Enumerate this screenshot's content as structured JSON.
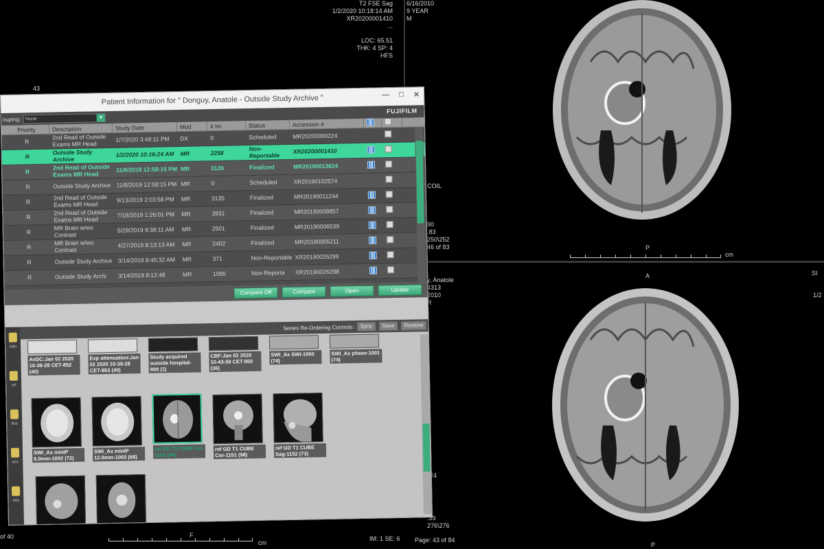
{
  "overlay_top_right": {
    "sequence": "T2 FSE Sag",
    "datetime": "1/2/2020 10:18:14 AM",
    "accession": "XR20200001410",
    "ellipsis": "...",
    "loc": "LOC: 65.51",
    "thk": "THK: 4 SP: 4",
    "position": "HFS",
    "dob": "6/16/2010",
    "age": "9 YEAR",
    "sex": "M"
  },
  "overlay_top_left": {
    "slice_num": "43"
  },
  "overlay_mid": {
    "coil": "COIL",
    "l1": "90",
    "l2": ".83",
    "l3": "250\\252",
    "l4": "46 of 83",
    "orient_bottom_top": "P",
    "cm_top": "cm"
  },
  "overlay_bottom": {
    "patient_name": "y, Anatole",
    "id_partial": "4313",
    "date_partial": "2010",
    "sex_partial": "R",
    "orient_a": "A",
    "right_s": "SI",
    "right_date": "1/2",
    "l24": "24",
    "l_ud": "l/",
    "l39": ".39",
    "l276": "276\\276",
    "page": "Page: 43 of 84",
    "im_se": "IM: 1 SE: 6",
    "of40": "of 40",
    "orient_f": "F",
    "cm_bot": "cm",
    "orient_p_bot": "P"
  },
  "dialog": {
    "title": "Patient Information for \" Donguy, Anatole  - Outside Study Archive \"",
    "win_min": "—",
    "win_max": "□",
    "win_close": "✕",
    "brand": "FUJIFILM",
    "grouping_label": "ouping:",
    "grouping_value": "None",
    "grouping_arrow": "▼",
    "columns": [
      "Priority",
      "Description",
      "Study Date",
      "Mod",
      "# Im",
      "Status",
      "Accession #"
    ],
    "rows": [
      {
        "priority": "R",
        "description": "2nd Read of Outside Exams MR Head",
        "date": "1/7/2020 3:49:11 PM",
        "mod": "DX",
        "im": "0",
        "status": "Scheduled",
        "accession": "MR20200000224",
        "icon": false
      },
      {
        "priority": "R",
        "description": "Outside Study Archive",
        "date": "1/2/2020 10:16:24 AM",
        "mod": "MR",
        "im": "2258",
        "status": "Non-Reportable",
        "accession": "XR20200001410",
        "icon": true
      },
      {
        "priority": "R",
        "description": "2nd Read of Outside Exams MR Head",
        "date": "11/8/2019 12:58:15 PM",
        "mod": "MR",
        "im": "3126",
        "status": "Finalized",
        "accession": "MR20190013824",
        "icon": true
      },
      {
        "priority": "R",
        "description": "Outside Study Archive",
        "date": "11/8/2019 12:58:15 PM",
        "mod": "MR",
        "im": "0",
        "status": "Scheduled",
        "accession": "XR20190102574",
        "icon": false
      },
      {
        "priority": "R",
        "description": "2nd Read of Outside Exams MR Head",
        "date": "9/13/2019 2:03:58 PM",
        "mod": "MR",
        "im": "3135",
        "status": "Finalized",
        "accession": "MR20190011244",
        "icon": true
      },
      {
        "priority": "R",
        "description": "2nd Read of Outside Exams MR Head",
        "date": "7/18/2019 1:26:01 PM",
        "mod": "MR",
        "im": "3931",
        "status": "Finalized",
        "accession": "MR20190008857",
        "icon": true
      },
      {
        "priority": "R",
        "description": "MR Brain w/wo Contrast",
        "date": "5/29/2019 9:38:11 AM",
        "mod": "MR",
        "im": "2501",
        "status": "Finalized",
        "accession": "MR20190006539",
        "icon": true
      },
      {
        "priority": "R",
        "description": "MR Brain w/wo Contrast",
        "date": "4/27/2019 8:13:13 AM",
        "mod": "MR",
        "im": "2402",
        "status": "Finalized",
        "accession": "MR20190005211",
        "icon": true
      },
      {
        "priority": "R",
        "description": "Outside Study Archive",
        "date": "3/14/2019 8:45:32 AM",
        "mod": "MR",
        "im": "371",
        "status": "Non-Reportable",
        "accession": "XR20190026299",
        "icon": true
      },
      {
        "priority": "R",
        "description": "Outside Study Archi",
        "date": "3/14/2019 8:12:48",
        "mod": "MR",
        "im": "1065",
        "status": "Non-Reporta",
        "accession": "XR20190026298",
        "icon": true
      }
    ],
    "buttons": [
      "Compare Off",
      "Compare",
      "Open",
      "Update"
    ],
    "series_controls_label": "Series Re-Ordering Controls:",
    "series_buttons": [
      "Sync",
      "Save",
      "Restore"
    ],
    "nav": [
      "Info",
      "ort",
      "ites",
      "ocs",
      "ries"
    ],
    "series": [
      {
        "label": "AvDC:Jan 02 2020 10-39-28 CET-852 (40)"
      },
      {
        "label": "Exp attenuation:Jan 02 2020 10-39-28 CET-853 (40)"
      },
      {
        "label": "Study acquired outside hospital-900 (1)"
      },
      {
        "label": "CBF:Jan 02 2020 10-43-59 CET-950 (36)"
      },
      {
        "label": "SWI_Ax SWI-1000 (74)"
      },
      {
        "label": "SWI_Ax phase-1001 (74)"
      },
      {
        "label": "SWI_Ax minIP 6.0mm-1002 (72)"
      },
      {
        "label": "SWI_Ax minIP 12.0mm-1003 (68)"
      },
      {
        "label": "ref GD T1 CUBE Ax-1150 (84)"
      },
      {
        "label": "ref GD T1 CUBE Cor-1151 (98)"
      },
      {
        "label": "ref GD T1 CUBE Sag-1152 (73)"
      }
    ]
  },
  "colors": {
    "accent": "#3fd69c",
    "button": "#3ba87a",
    "icon_blue": "#2a78c8"
  }
}
